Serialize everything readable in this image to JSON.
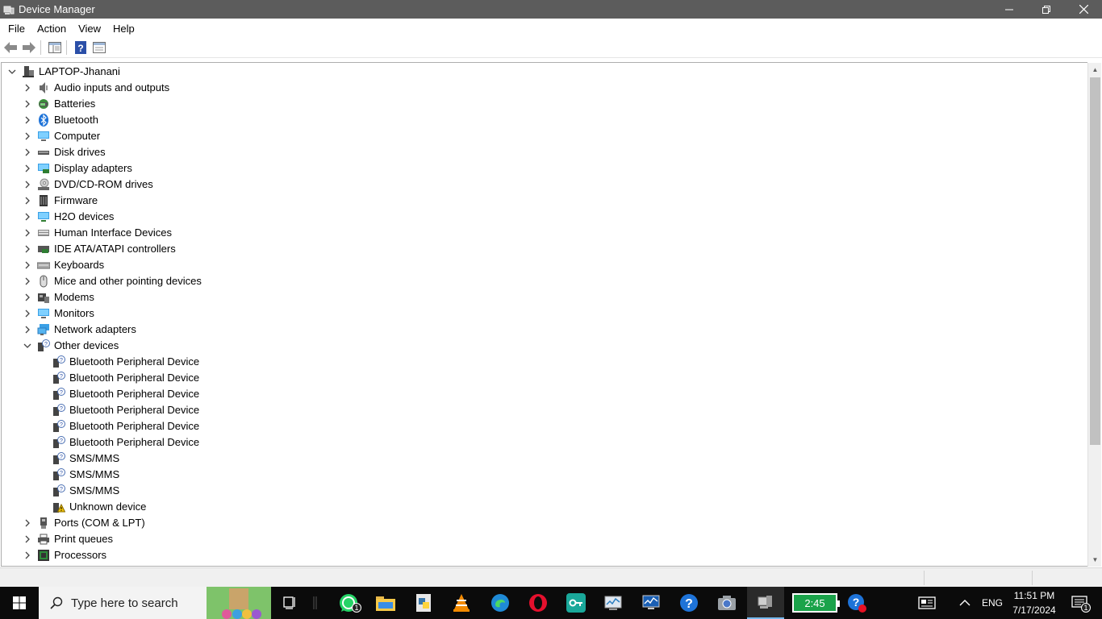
{
  "window": {
    "title": "Device Manager"
  },
  "menu": [
    "File",
    "Action",
    "View",
    "Help"
  ],
  "toolbar": {
    "icons": [
      "back-arrow-icon",
      "forward-arrow-icon",
      "properties-pane-icon",
      "help-icon",
      "show-hidden-icon"
    ]
  },
  "tree": {
    "root": "LAPTOP-Jhanani",
    "categories": [
      {
        "label": "Audio inputs and outputs",
        "icon": "speaker-icon",
        "expanded": false
      },
      {
        "label": "Batteries",
        "icon": "battery-icon",
        "expanded": false
      },
      {
        "label": "Bluetooth",
        "icon": "bluetooth-icon",
        "expanded": false
      },
      {
        "label": "Computer",
        "icon": "computer-icon",
        "expanded": false
      },
      {
        "label": "Disk drives",
        "icon": "disk-icon",
        "expanded": false
      },
      {
        "label": "Display adapters",
        "icon": "display-adapter-icon",
        "expanded": false
      },
      {
        "label": "DVD/CD-ROM drives",
        "icon": "dvd-icon",
        "expanded": false
      },
      {
        "label": "Firmware",
        "icon": "firmware-icon",
        "expanded": false
      },
      {
        "label": "H2O devices",
        "icon": "monitor-icon",
        "expanded": false
      },
      {
        "label": "Human Interface Devices",
        "icon": "hid-icon",
        "expanded": false
      },
      {
        "label": "IDE ATA/ATAPI controllers",
        "icon": "ide-controller-icon",
        "expanded": false
      },
      {
        "label": "Keyboards",
        "icon": "keyboard-icon",
        "expanded": false
      },
      {
        "label": "Mice and other pointing devices",
        "icon": "mouse-icon",
        "expanded": false
      },
      {
        "label": "Modems",
        "icon": "modem-icon",
        "expanded": false
      },
      {
        "label": "Monitors",
        "icon": "monitor-icon",
        "expanded": false
      },
      {
        "label": "Network adapters",
        "icon": "network-adapter-icon",
        "expanded": false
      },
      {
        "label": "Other devices",
        "icon": "unknown-device-icon",
        "expanded": true,
        "children": [
          {
            "label": "Bluetooth Peripheral Device",
            "icon": "unknown-device-icon"
          },
          {
            "label": "Bluetooth Peripheral Device",
            "icon": "unknown-device-icon"
          },
          {
            "label": "Bluetooth Peripheral Device",
            "icon": "unknown-device-icon"
          },
          {
            "label": "Bluetooth Peripheral Device",
            "icon": "unknown-device-icon"
          },
          {
            "label": "Bluetooth Peripheral Device",
            "icon": "unknown-device-icon"
          },
          {
            "label": "Bluetooth Peripheral Device",
            "icon": "unknown-device-icon"
          },
          {
            "label": "SMS/MMS",
            "icon": "unknown-device-icon"
          },
          {
            "label": "SMS/MMS",
            "icon": "unknown-device-icon"
          },
          {
            "label": "SMS/MMS",
            "icon": "unknown-device-icon"
          },
          {
            "label": "Unknown device",
            "icon": "warning-device-icon"
          }
        ]
      },
      {
        "label": "Ports (COM & LPT)",
        "icon": "port-icon",
        "expanded": false
      },
      {
        "label": "Print queues",
        "icon": "printer-icon",
        "expanded": false
      },
      {
        "label": "Processors",
        "icon": "processor-icon",
        "expanded": false
      }
    ]
  },
  "taskbar": {
    "search_placeholder": "Type here to search",
    "whatsapp_badge": "1",
    "battery_app_label": "2:45",
    "language": "ENG",
    "time": "11:51 PM",
    "date": "7/17/2024",
    "notifications_badge": "1"
  },
  "colors": {
    "titlebar": "#5c5c5c",
    "taskbar": "#0b0b0b",
    "accent_blue": "#1e90ff",
    "battery_green": "#1aa34a"
  }
}
